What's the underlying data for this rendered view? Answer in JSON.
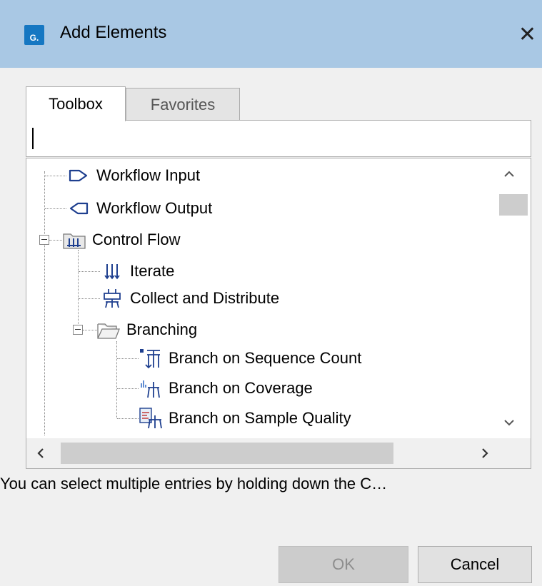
{
  "window": {
    "app_icon_text": "G.",
    "title": "Add Elements",
    "close_glyph": "✕"
  },
  "tabs": [
    {
      "label": "Toolbox",
      "selected": true
    },
    {
      "label": "Favorites",
      "selected": false
    }
  ],
  "search": {
    "value": ""
  },
  "tree": {
    "items": [
      {
        "label": "Workflow Input",
        "icon": "workflow-input-icon"
      },
      {
        "label": "Workflow Output",
        "icon": "workflow-output-icon"
      },
      {
        "label": "Control Flow",
        "icon": "folder-icon",
        "expanded": true
      },
      {
        "label": "Iterate",
        "icon": "iterate-icon"
      },
      {
        "label": "Collect and Distribute",
        "icon": "collect-distribute-icon"
      },
      {
        "label": "Branching",
        "icon": "folder-open-icon",
        "expanded": true
      },
      {
        "label": "Branch on Sequence Count",
        "icon": "branch-sequence-count-icon"
      },
      {
        "label": "Branch on Coverage",
        "icon": "branch-coverage-icon"
      },
      {
        "label": "Branch on Sample Quality",
        "icon": "branch-sample-quality-icon"
      }
    ]
  },
  "hint_text": "You can select multiple entries by holding down the C…",
  "buttons": {
    "ok": "OK",
    "cancel": "Cancel"
  },
  "colors": {
    "titlebar": "#a9c8e4",
    "app_icon": "#1577c2",
    "icon_blue": "#1e3f8f"
  }
}
